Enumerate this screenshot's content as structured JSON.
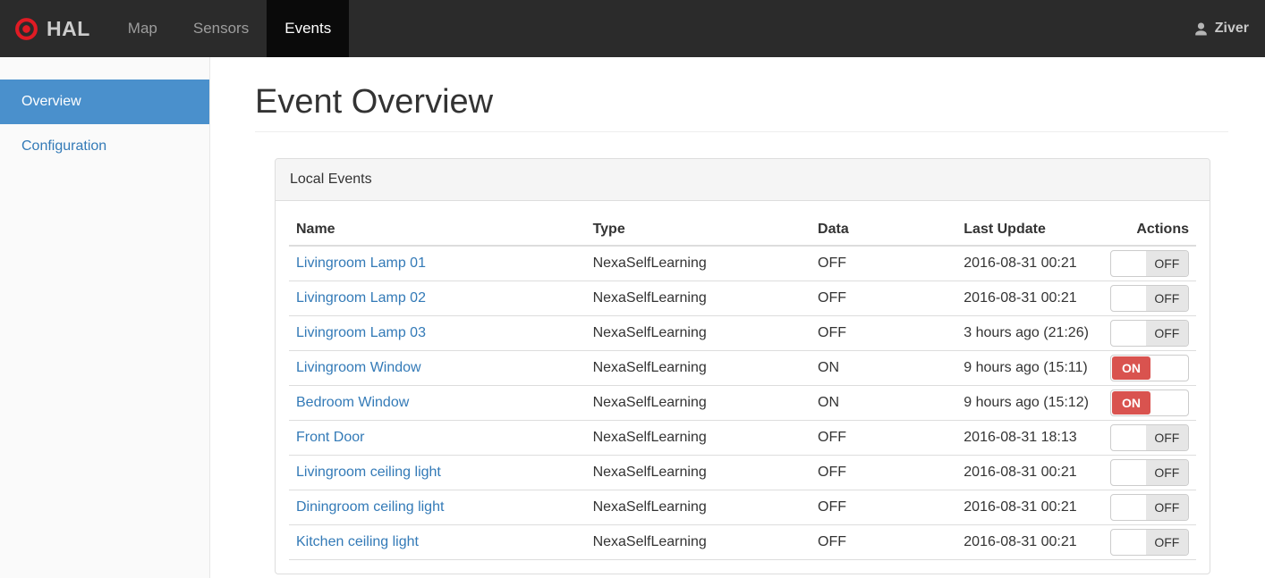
{
  "navbar": {
    "brand": "HAL",
    "items": [
      {
        "label": "Map",
        "active": false
      },
      {
        "label": "Sensors",
        "active": false
      },
      {
        "label": "Events",
        "active": true
      }
    ],
    "user": "Ziver"
  },
  "sidebar": {
    "items": [
      {
        "label": "Overview",
        "active": true
      },
      {
        "label": "Configuration",
        "active": false
      }
    ]
  },
  "main": {
    "title": "Event Overview",
    "panel": {
      "title": "Local Events",
      "table": {
        "columns": [
          "Name",
          "Type",
          "Data",
          "Last Update",
          "Actions"
        ],
        "rows": [
          {
            "name": "Livingroom Lamp 01",
            "type": "NexaSelfLearning",
            "data": "OFF",
            "last_update": "2016-08-31 00:21",
            "state": "OFF"
          },
          {
            "name": "Livingroom Lamp 02",
            "type": "NexaSelfLearning",
            "data": "OFF",
            "last_update": "2016-08-31 00:21",
            "state": "OFF"
          },
          {
            "name": "Livingroom Lamp 03",
            "type": "NexaSelfLearning",
            "data": "OFF",
            "last_update": "3 hours ago (21:26)",
            "state": "OFF"
          },
          {
            "name": "Livingroom Window",
            "type": "NexaSelfLearning",
            "data": "ON",
            "last_update": "9 hours ago (15:11)",
            "state": "ON"
          },
          {
            "name": "Bedroom Window",
            "type": "NexaSelfLearning",
            "data": "ON",
            "last_update": "9 hours ago (15:12)",
            "state": "ON"
          },
          {
            "name": "Front Door",
            "type": "NexaSelfLearning",
            "data": "OFF",
            "last_update": "2016-08-31 18:13",
            "state": "OFF"
          },
          {
            "name": "Livingroom ceiling light",
            "type": "NexaSelfLearning",
            "data": "OFF",
            "last_update": "2016-08-31 00:21",
            "state": "OFF"
          },
          {
            "name": "Diningroom ceiling light",
            "type": "NexaSelfLearning",
            "data": "OFF",
            "last_update": "2016-08-31 00:21",
            "state": "OFF"
          },
          {
            "name": "Kitchen ceiling light",
            "type": "NexaSelfLearning",
            "data": "OFF",
            "last_update": "2016-08-31 00:21",
            "state": "OFF"
          }
        ]
      }
    }
  },
  "icons": {
    "brand": "bullseye-icon",
    "user": "person-icon"
  },
  "colors": {
    "navbar_bg": "#2b2b2b",
    "navbar_active_bg": "#0a0a0a",
    "brand_red": "#e01b24",
    "sidebar_active_blue": "#4a90cc",
    "link_blue": "#337ab7",
    "toggle_on_red": "#d9534f",
    "toggle_off_gray": "#e6e6e6"
  }
}
